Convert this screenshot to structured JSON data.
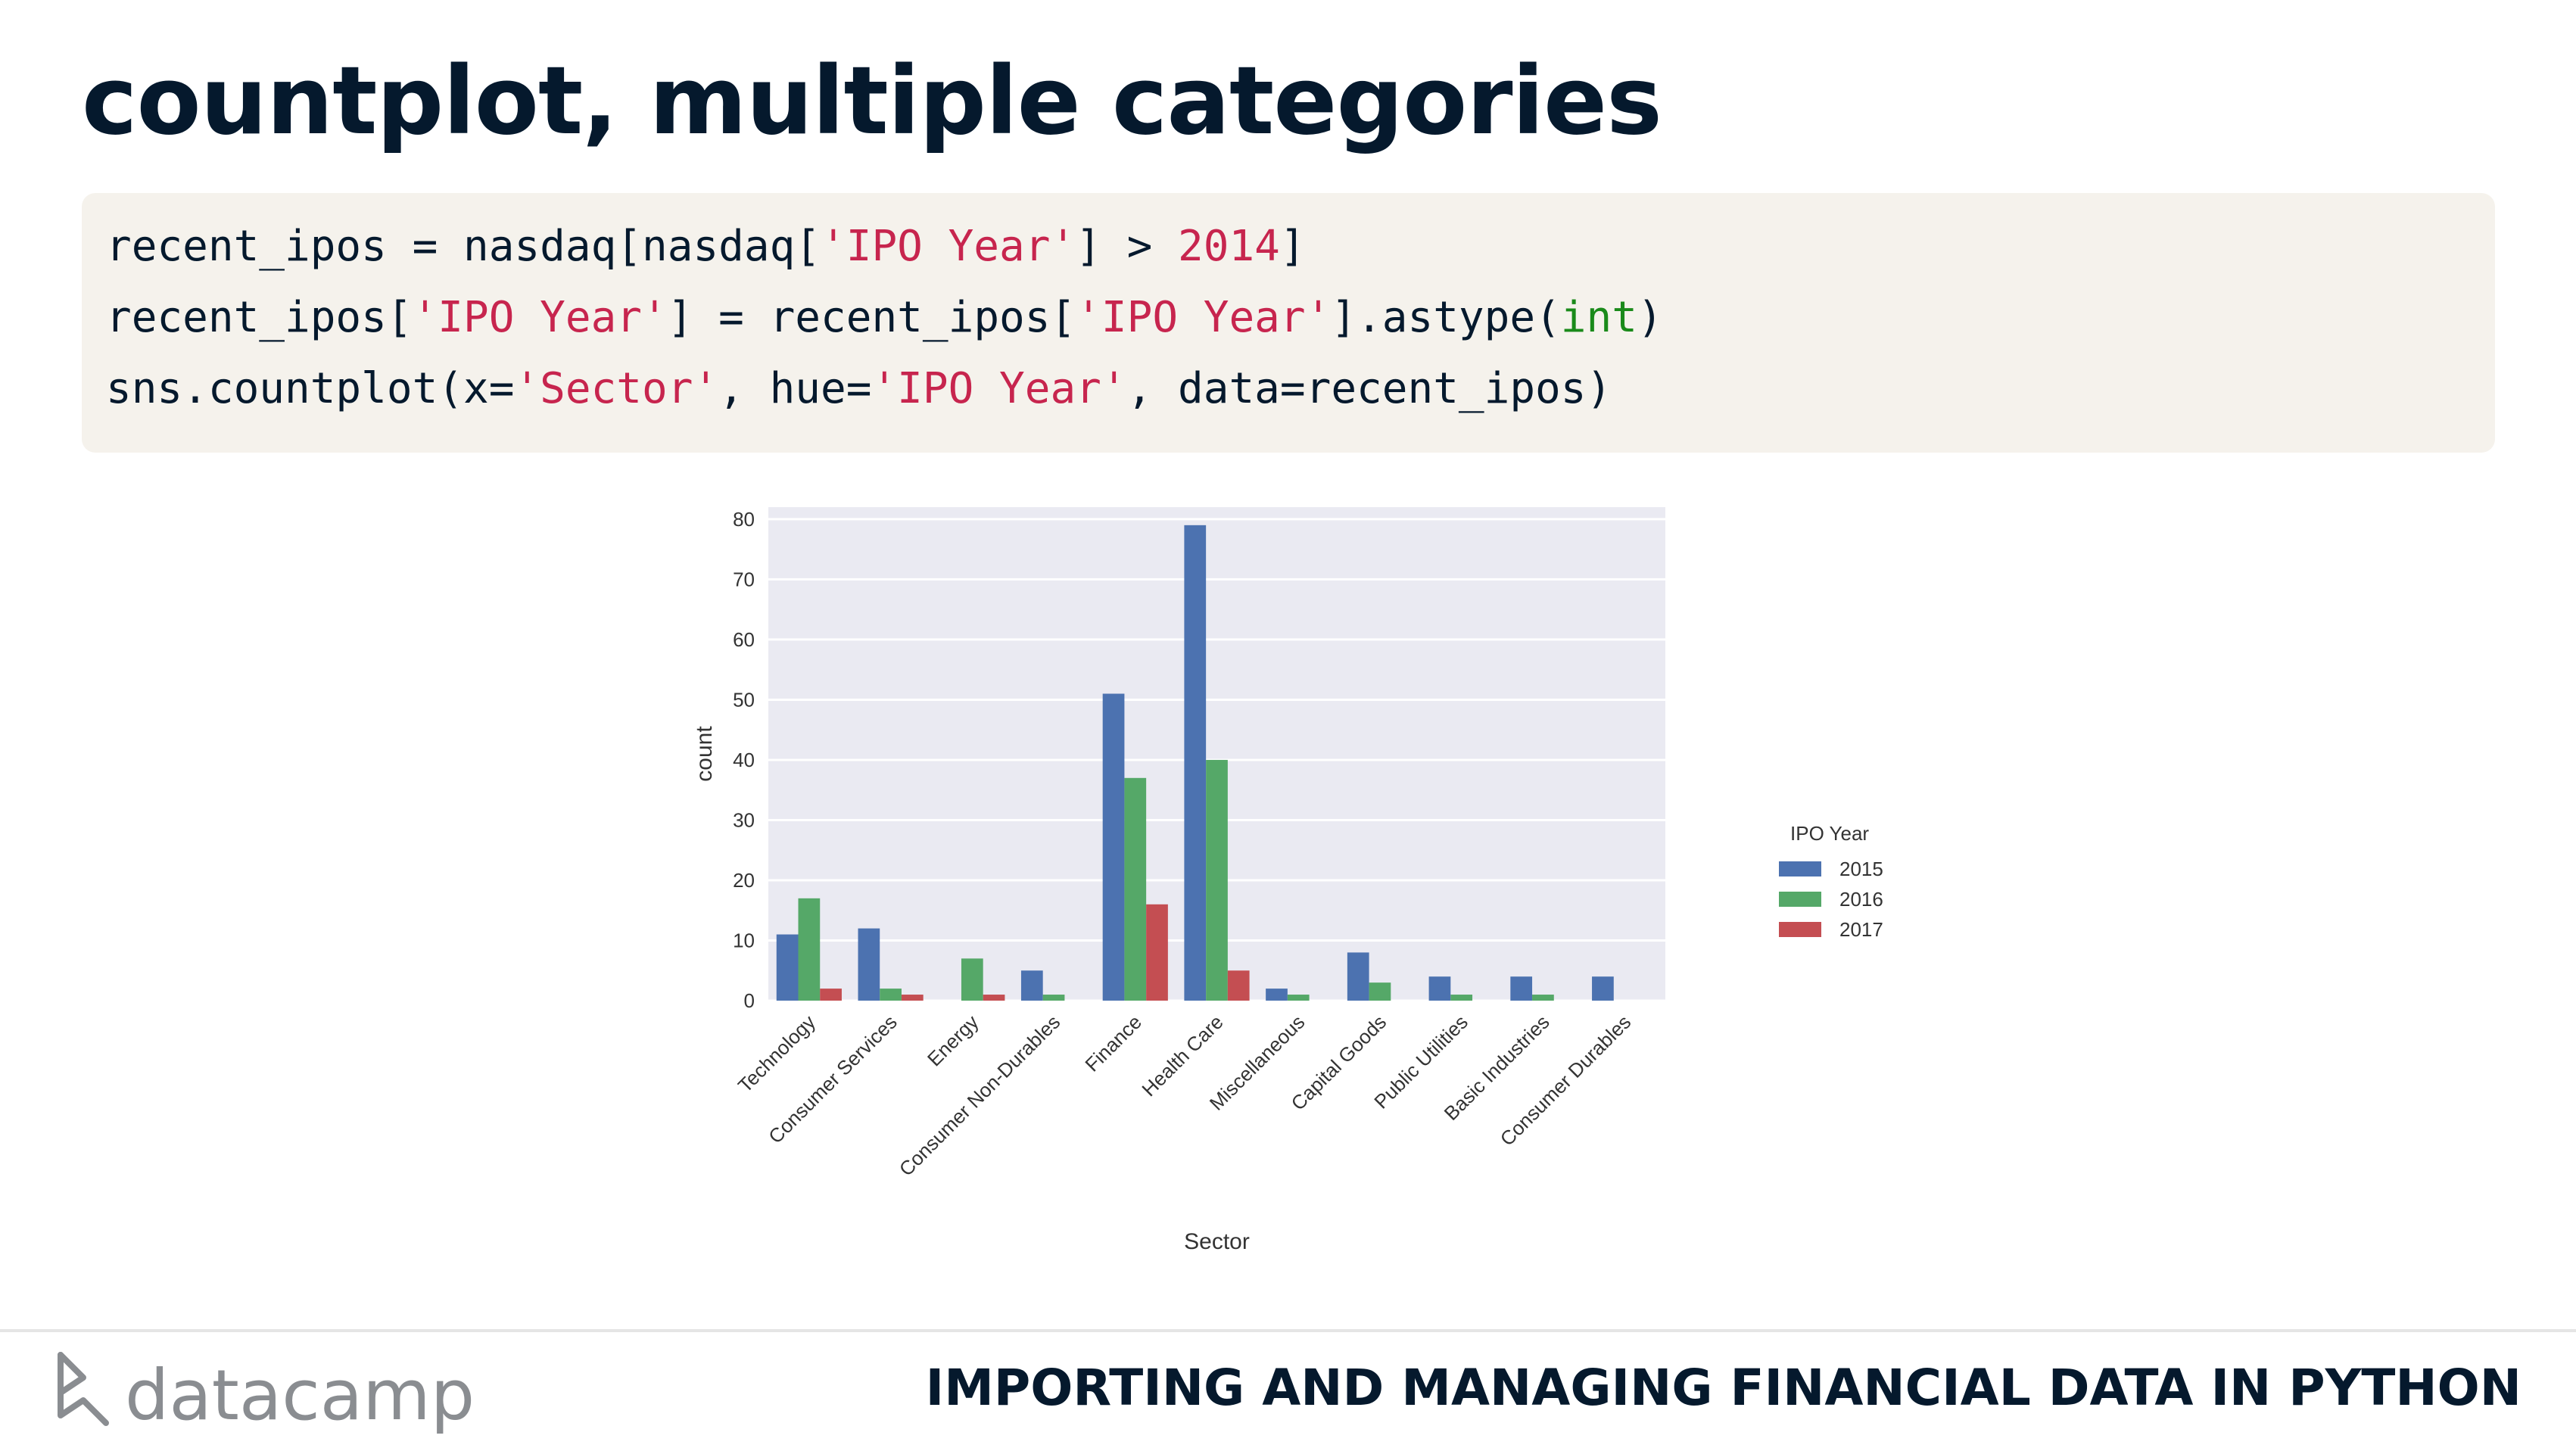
{
  "slide": {
    "title": "countplot, multiple categories",
    "course_title": "IMPORTING AND MANAGING FINANCIAL DATA IN PYTHON",
    "brand": "datacamp"
  },
  "code": {
    "line1": [
      {
        "t": "recent_ipos = nasdaq[nasdaq[",
        "c": "plain"
      },
      {
        "t": "'IPO Year'",
        "c": "str"
      },
      {
        "t": "] > ",
        "c": "plain"
      },
      {
        "t": "2014",
        "c": "num"
      },
      {
        "t": "]",
        "c": "plain"
      }
    ],
    "line2": [
      {
        "t": "recent_ipos[",
        "c": "plain"
      },
      {
        "t": "'IPO Year'",
        "c": "str"
      },
      {
        "t": "] = recent_ipos[",
        "c": "plain"
      },
      {
        "t": "'IPO Year'",
        "c": "str"
      },
      {
        "t": "].astype(",
        "c": "plain"
      },
      {
        "t": "int",
        "c": "kw"
      },
      {
        "t": ")",
        "c": "plain"
      }
    ],
    "line3": [
      {
        "t": "sns.countplot(x=",
        "c": "plain"
      },
      {
        "t": "'Sector'",
        "c": "str"
      },
      {
        "t": ", hue=",
        "c": "plain"
      },
      {
        "t": "'IPO Year'",
        "c": "str"
      },
      {
        "t": ", data=recent_ipos)",
        "c": "plain"
      }
    ]
  },
  "colors": {
    "series": [
      "#4c72b0",
      "#55a868",
      "#c44e52"
    ],
    "plot_bg": "#eaeaf2",
    "grid": "#ffffff"
  },
  "chart_data": {
    "type": "bar",
    "xlabel": "Sector",
    "ylabel": "count",
    "ylim": [
      0,
      82
    ],
    "yticks": [
      0,
      10,
      20,
      30,
      40,
      50,
      60,
      70,
      80
    ],
    "grid": true,
    "legend_title": "IPO Year",
    "legend_placement": "outside-right",
    "categories": [
      "Technology",
      "Consumer Services",
      "Energy",
      "Consumer Non-Durables",
      "Finance",
      "Health Care",
      "Miscellaneous",
      "Capital Goods",
      "Public Utilities",
      "Basic Industries",
      "Consumer Durables"
    ],
    "series": [
      {
        "name": "2015",
        "values": [
          11,
          12,
          0,
          5,
          51,
          79,
          2,
          8,
          4,
          4,
          4
        ]
      },
      {
        "name": "2016",
        "values": [
          17,
          2,
          7,
          1,
          37,
          40,
          1,
          3,
          1,
          1,
          0
        ]
      },
      {
        "name": "2017",
        "values": [
          2,
          1,
          1,
          0,
          16,
          5,
          0,
          0,
          0,
          0,
          0
        ]
      }
    ]
  }
}
